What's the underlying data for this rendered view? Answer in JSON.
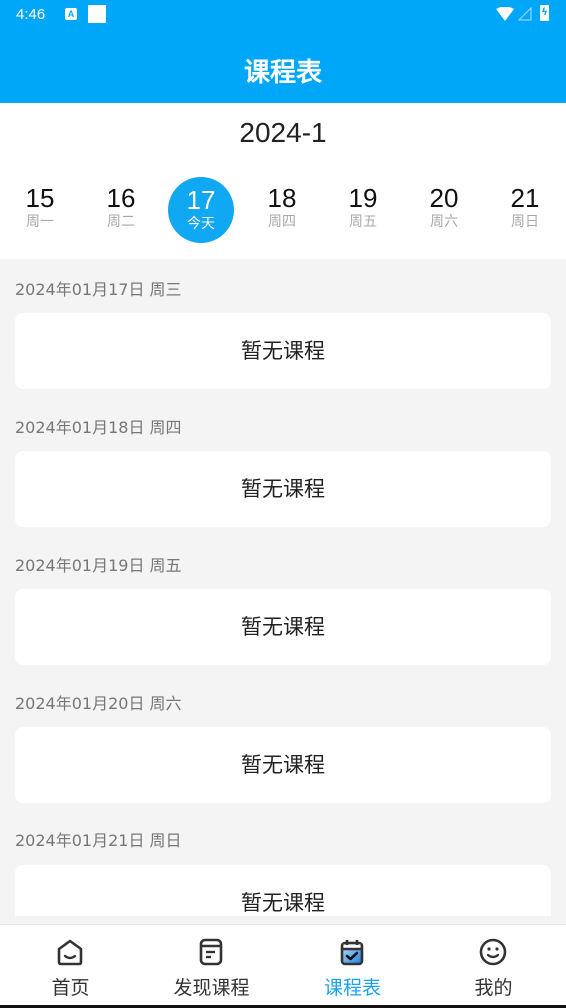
{
  "status_bar": {
    "time": "4:46",
    "notification_icon": "A"
  },
  "header": {
    "title": "课程表"
  },
  "calendar": {
    "month": "2024-1",
    "days": [
      {
        "num": "15",
        "weekday": "周一",
        "today": false
      },
      {
        "num": "16",
        "weekday": "周二",
        "today": false
      },
      {
        "num": "17",
        "weekday": "今天",
        "today": true
      },
      {
        "num": "18",
        "weekday": "周四",
        "today": false
      },
      {
        "num": "19",
        "weekday": "周五",
        "today": false
      },
      {
        "num": "20",
        "weekday": "周六",
        "today": false
      },
      {
        "num": "21",
        "weekday": "周日",
        "today": false
      }
    ]
  },
  "schedule": [
    {
      "date": "2024年01月17日 周三",
      "content": "暂无课程"
    },
    {
      "date": "2024年01月18日 周四",
      "content": "暂无课程"
    },
    {
      "date": "2024年01月19日 周五",
      "content": "暂无课程"
    },
    {
      "date": "2024年01月20日 周六",
      "content": "暂无课程"
    },
    {
      "date": "2024年01月21日 周日",
      "content": "暂无课程"
    }
  ],
  "tabbar": {
    "items": [
      {
        "label": "首页",
        "icon": "home-icon",
        "active": false
      },
      {
        "label": "发现课程",
        "icon": "course-icon",
        "active": false
      },
      {
        "label": "课程表",
        "icon": "calendar-icon",
        "active": true
      },
      {
        "label": "我的",
        "icon": "smiley-icon",
        "active": false
      }
    ]
  },
  "colors": {
    "primary": "#00a7f8",
    "active_tab": "#1aa3ee",
    "background": "#f4f4f5"
  }
}
